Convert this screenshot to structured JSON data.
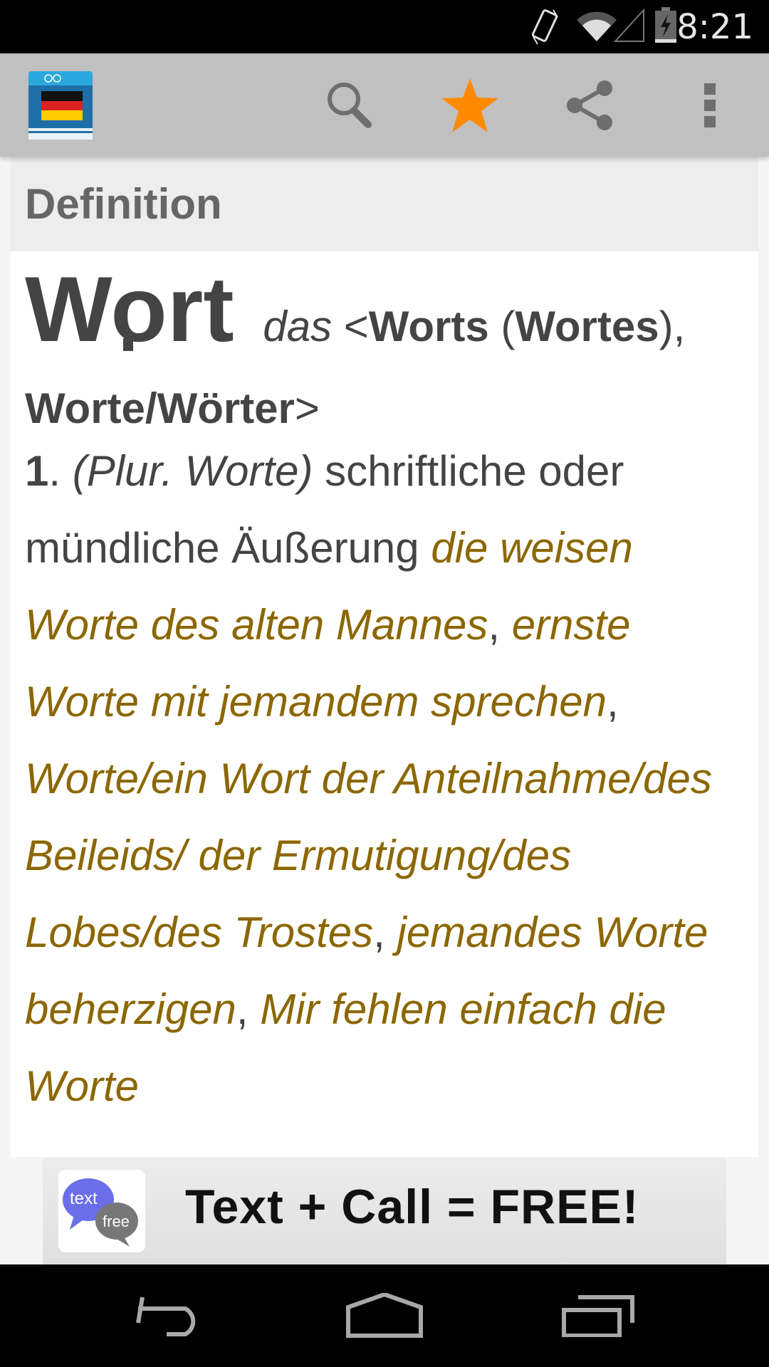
{
  "status_bar": {
    "time": "8:21",
    "icons": [
      "vibrate-icon",
      "wifi-icon",
      "signal-icon",
      "battery-charging-icon"
    ]
  },
  "action_bar": {
    "app_icon": "german-dictionary-book-icon",
    "actions": [
      {
        "name": "search",
        "icon": "search-icon"
      },
      {
        "name": "favorite",
        "icon": "star-icon",
        "active": true,
        "color": "#ff8a00"
      },
      {
        "name": "share",
        "icon": "share-icon"
      },
      {
        "name": "overflow",
        "icon": "more-vert-icon"
      }
    ]
  },
  "section": {
    "title": "Definition"
  },
  "entry": {
    "headword": "Wort",
    "article": "das",
    "grammar_open": "<",
    "genitive": "Worts",
    "genitive_alt_open": " (",
    "genitive_alt": "Wortes",
    "genitive_alt_close": "),",
    "plural": "Worte/Wörter",
    "grammar_close": ">",
    "sense_number": "1",
    "sense_dot": ". ",
    "sense_note": "(Plur. Worte)",
    "sense_definition": " schriftliche oder mündliche Äußerung ",
    "examples": [
      "die weisen Worte des alten Mannes",
      "ernste Worte mit jemandem sprechen",
      "Worte/ein Wort der Anteilnahme/des Beileids/ der Ermutigung/des Lobes/des Trostes",
      "jemandes Worte beherzigen",
      "Mir fehlen einfach die Worte"
    ],
    "separator": ", ",
    "colors": {
      "text": "#444444",
      "example": "#8c6700"
    }
  },
  "ad": {
    "logo_top": "text",
    "logo_bottom": "free",
    "text": "Text + Call = FREE!"
  },
  "nav_bar": {
    "buttons": [
      "back-icon",
      "home-icon",
      "recents-icon"
    ]
  }
}
